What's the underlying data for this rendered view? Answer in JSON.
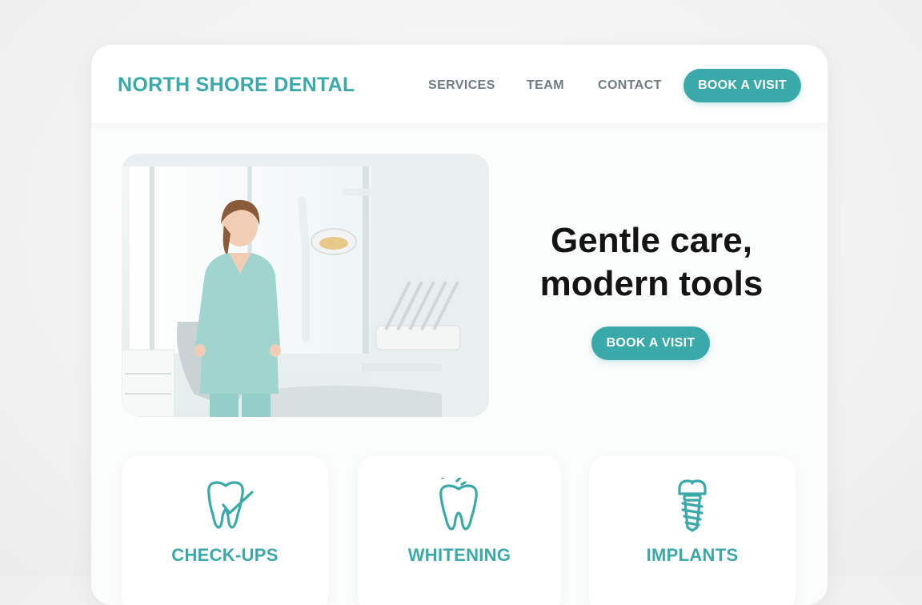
{
  "brand": {
    "name": "NORTH SHORE DENTAL",
    "accent_color": "#3aa9a9"
  },
  "nav": {
    "items": [
      {
        "label": "SERVICES"
      },
      {
        "label": "TEAM"
      },
      {
        "label": "CONTACT"
      }
    ],
    "cta_label": "BOOK A VISIT"
  },
  "hero": {
    "headline_line1": "Gentle care,",
    "headline_line2": "modern tools",
    "cta_label": "BOOK A VISIT",
    "image_subject": "dentist-in-clinic-photo"
  },
  "services": [
    {
      "label": "CHECK-UPS",
      "icon": "tooth-check-icon"
    },
    {
      "label": "WHITENING",
      "icon": "tooth-sparkle-icon"
    },
    {
      "label": "IMPLANTS",
      "icon": "dental-implant-icon"
    }
  ]
}
